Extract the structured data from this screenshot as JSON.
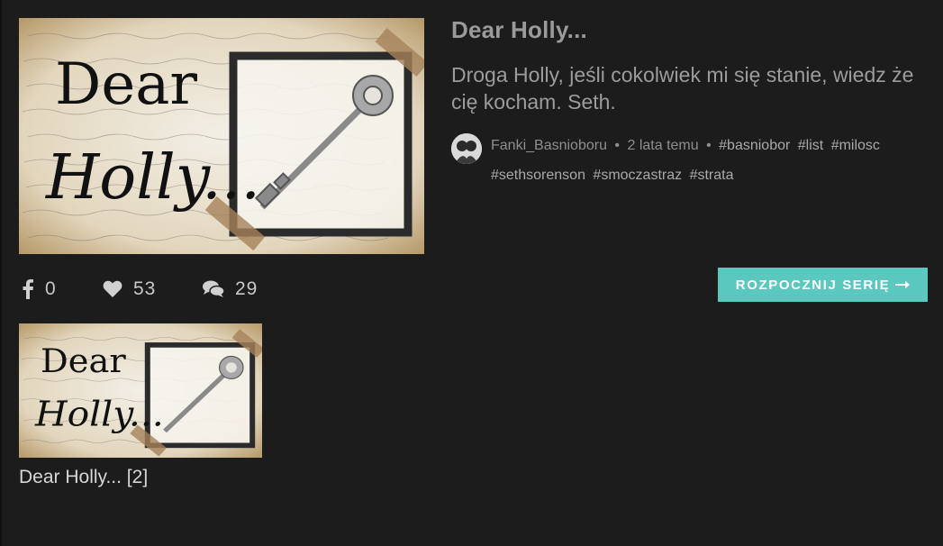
{
  "story": {
    "title": "Dear Holly...",
    "description": "Droga Holly, jeśli cokolwiek mi się stanie, wiedz że cię kocham. Seth.",
    "author": "Fanki_Basnioboru",
    "separator": "•",
    "time_ago": "2 lata temu",
    "tags": [
      "#basniobor",
      "#list",
      "#milosc",
      "#sethsorenson",
      "#smoczastraz",
      "#strata"
    ],
    "cover_alt": "Dear Holly... cover with antique key"
  },
  "stats": {
    "facebook_icon": "facebook-icon",
    "facebook_count": "0",
    "likes_icon": "heart-icon",
    "likes_count": "53",
    "comments_icon": "comments-icon",
    "comments_count": "29"
  },
  "actions": {
    "start_series_label": "ROZPOCZNIJ SERIĘ",
    "start_series_icon": "arrow-right-icon"
  },
  "chapters": [
    {
      "title": "Dear Holly... [2]"
    }
  ],
  "colors": {
    "background": "#1c1c1c",
    "accent": "#5bc8c0"
  }
}
